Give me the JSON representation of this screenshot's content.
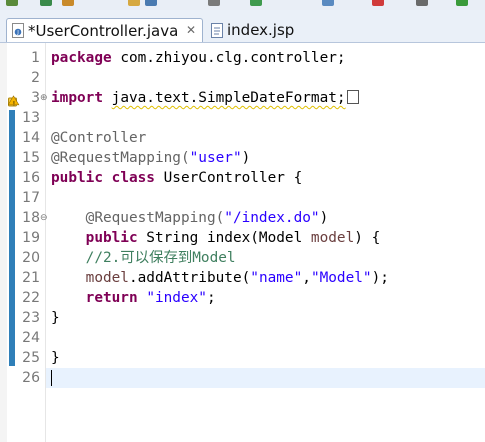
{
  "tabs": [
    {
      "label": "*UserController.java",
      "close": "✕",
      "active": true
    },
    {
      "label": "index.jsp",
      "active": false
    }
  ],
  "editor": {
    "lines": [
      {
        "num": "1",
        "tokens": [
          {
            "t": "package",
            "c": "kw"
          },
          {
            "t": " com.zhiyou.clg.controller;",
            "c": ""
          }
        ]
      },
      {
        "num": "2",
        "tokens": []
      },
      {
        "num": "3",
        "fold": "+",
        "warning": true,
        "tokens": [
          {
            "t": "import",
            "c": "kw"
          },
          {
            "t": " ",
            "c": ""
          },
          {
            "t": "java.text.SimpleDateFormat;",
            "c": "warn"
          }
        ],
        "folded_box": true
      },
      {
        "num": "13",
        "tokens": []
      },
      {
        "num": "14",
        "tokens": [
          {
            "t": "@Controller",
            "c": "ann"
          }
        ]
      },
      {
        "num": "15",
        "tokens": [
          {
            "t": "@RequestMapping(",
            "c": "ann"
          },
          {
            "t": "\"user\"",
            "c": "str"
          },
          {
            "t": ")",
            "c": ""
          }
        ]
      },
      {
        "num": "16",
        "tokens": [
          {
            "t": "public",
            "c": "kw"
          },
          {
            "t": " ",
            "c": ""
          },
          {
            "t": "class",
            "c": "kw"
          },
          {
            "t": " UserController {",
            "c": ""
          }
        ]
      },
      {
        "num": "17",
        "tokens": []
      },
      {
        "num": "18",
        "fold": "−",
        "tokens": [
          {
            "t": "    @RequestMapping(",
            "c": "ann"
          },
          {
            "t": "\"/index.do\"",
            "c": "str"
          },
          {
            "t": ")",
            "c": ""
          }
        ]
      },
      {
        "num": "19",
        "tokens": [
          {
            "t": "    ",
            "c": ""
          },
          {
            "t": "public",
            "c": "kw"
          },
          {
            "t": " String index(Model ",
            "c": ""
          },
          {
            "t": "model",
            "c": "var"
          },
          {
            "t": ") {",
            "c": ""
          }
        ]
      },
      {
        "num": "20",
        "tokens": [
          {
            "t": "    //2.可以保存到Model",
            "c": "cmt"
          }
        ]
      },
      {
        "num": "21",
        "tokens": [
          {
            "t": "    ",
            "c": ""
          },
          {
            "t": "model",
            "c": "var"
          },
          {
            "t": ".addAttribute(",
            "c": ""
          },
          {
            "t": "\"name\"",
            "c": "str"
          },
          {
            "t": ",",
            "c": ""
          },
          {
            "t": "\"Model\"",
            "c": "str"
          },
          {
            "t": ");",
            "c": ""
          }
        ]
      },
      {
        "num": "22",
        "tokens": [
          {
            "t": "    ",
            "c": ""
          },
          {
            "t": "return",
            "c": "kw"
          },
          {
            "t": " ",
            "c": ""
          },
          {
            "t": "\"index\"",
            "c": "str"
          },
          {
            "t": ";",
            "c": ""
          }
        ]
      },
      {
        "num": "23",
        "tokens": [
          {
            "t": "}",
            "c": ""
          }
        ]
      },
      {
        "num": "24",
        "tokens": []
      },
      {
        "num": "25",
        "tokens": [
          {
            "t": "}",
            "c": ""
          }
        ]
      },
      {
        "num": "26",
        "tokens": [],
        "current": true
      }
    ]
  },
  "colors": {
    "keyword": "#7f0055",
    "annotation": "#646464",
    "string": "#2a00ff",
    "comment": "#3f7f5f",
    "variable": "#6a3e3e",
    "quick_diff_bar": "#2f7fb8",
    "current_line": "#e8f2fe"
  },
  "icons": {
    "java_file": "java-file-icon",
    "jsp_file": "jsp-file-icon",
    "warning": "warning-icon",
    "close": "close-icon"
  }
}
